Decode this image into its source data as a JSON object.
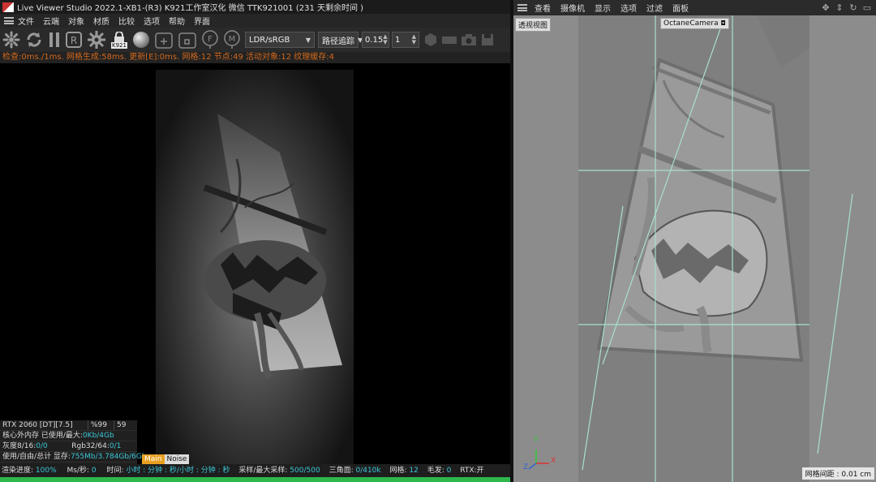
{
  "app": {
    "title": "Live Viewer Studio 2022.1-XB1-(R3)  K921工作室汉化  微信  TTK921001 (231 天剩余时间 )"
  },
  "menu": {
    "items": [
      "文件",
      "云端",
      "对象",
      "材质",
      "比较",
      "选项",
      "帮助",
      "界面"
    ]
  },
  "toolbar": {
    "lock_badge": "K921",
    "colorspace": "LDR/sRGB",
    "kernel": "路径追踪",
    "value1": "0.15",
    "value2": "1",
    "icons": [
      "octane-logo-icon",
      "refresh-icon",
      "pause-icon",
      "region-r-icon",
      "settings-gear-icon",
      "lock-icon",
      "sphere-icon",
      "add-region-icon",
      "pick-focus-icon",
      "focus-f-icon",
      "material-m-icon",
      "hexagon-icon",
      "rect-icon",
      "camera-icon",
      "save-icon"
    ]
  },
  "status_line": "检查:0ms./1ms. 网格生成:58ms. 更新[E]:0ms. 网格:12 节点:49 活动对象:12 纹理缓存:4",
  "stats": {
    "gpu": "RTX 2060 [DT][7.5]",
    "gpu_pct": "%99",
    "gpu_temp": "59",
    "ooc_label": "核心外内存 已使用/最大:",
    "ooc_value": "0Kb/4Gb",
    "grey_label": "灰度8/16: ",
    "grey_value": "0/0",
    "rgb_label": "Rgb32/64: ",
    "rgb_value": "0/1",
    "vram_label": "使用/自由/总计 显存: ",
    "vram_value": "755Mb/3.784Gb/6Gb",
    "tab_main": "Main",
    "tab_noise": "Noise"
  },
  "bottom": {
    "progress_label": "渲染进度: ",
    "progress_value": "100%",
    "progress_fraction": 1.0,
    "ms_label": "Ms/秒: ",
    "ms_value": "0",
    "time_label": "时间: ",
    "time_value": "小时 : 分钟 : 秒/小时 : 分钟 : 秒",
    "samples_label": "采样/最大采样: ",
    "samples_value": "500/500",
    "tris_label": "三角面: ",
    "tris_value": "0/410k",
    "mesh_label": "网格: ",
    "mesh_value": "12",
    "hair_label": "毛发: ",
    "hair_value": "0",
    "rtx": "RTX:开"
  },
  "viewport_menu": {
    "items": [
      "查看",
      "摄像机",
      "显示",
      "选项",
      "过滤",
      "面板"
    ],
    "active": "选项"
  },
  "viewport": {
    "view_name": "透视视图",
    "camera_name": "OctaneCamera",
    "grid_spacing": "网格间距 : 0.01 cm",
    "axis_y": "Y",
    "axis_z": "Z",
    "axis_x": "X"
  },
  "colors": {
    "status_orange": "#d2691e",
    "stat_cyan": "#3cc8d8",
    "progress_green": "#2db84d",
    "active_menu": "#e0c044",
    "tab_main_bg": "#e8a020"
  }
}
